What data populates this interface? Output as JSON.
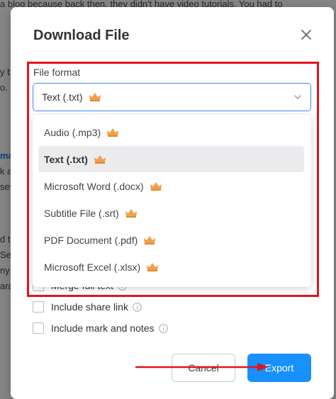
{
  "background": {
    "lines": [
      "a blog because back then, they didn't have video tutorials. You had to",
      "y b",
      "o. I",
      "ma",
      "k a",
      "sev",
      "d t",
      "Se",
      "ny",
      "ara"
    ]
  },
  "dialog": {
    "title": "Download File",
    "close_icon": "close-icon"
  },
  "file_format": {
    "label": "File format",
    "selected": "Text (.txt)",
    "options": [
      {
        "label": "Audio (.mp3)",
        "premium": true
      },
      {
        "label": "Text (.txt)",
        "premium": true,
        "selected": true
      },
      {
        "label": "Microsoft Word (.docx)",
        "premium": true
      },
      {
        "label": "Subtitle File (.srt)",
        "premium": true
      },
      {
        "label": "PDF Document (.pdf)",
        "premium": true
      },
      {
        "label": "Microsoft Excel (.xlsx)",
        "premium": true
      }
    ]
  },
  "checkboxes": [
    {
      "label": "Merge full text",
      "checked": false
    },
    {
      "label": "Include share link",
      "checked": false
    },
    {
      "label": "Include mark and notes",
      "checked": false
    }
  ],
  "buttons": {
    "cancel": "Cancel",
    "export": "Export"
  },
  "colors": {
    "accent": "#1890ff",
    "highlight": "#e0141e",
    "crown": "#f0a04b"
  }
}
